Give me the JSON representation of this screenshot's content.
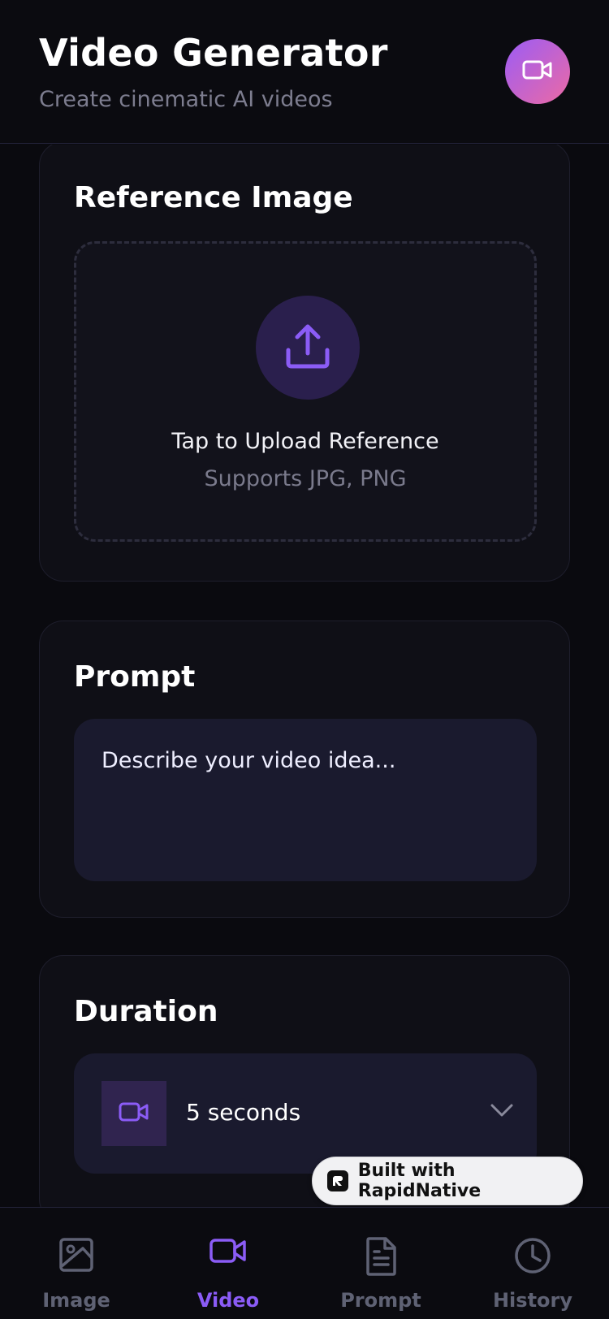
{
  "header": {
    "title": "Video Generator",
    "subtitle": "Create cinematic AI videos",
    "badge_icon": "video-camera-icon",
    "badge_gradient": [
      "#9b5cf6",
      "#ec6aa4"
    ]
  },
  "reference": {
    "title": "Reference Image",
    "upload_icon": "upload-icon",
    "upload_label": "Tap to Upload Reference",
    "upload_hint": "Supports JPG, PNG"
  },
  "prompt": {
    "title": "Prompt",
    "placeholder": "Describe your video idea..."
  },
  "duration": {
    "title": "Duration",
    "icon": "video-camera-icon",
    "selected": "5 seconds"
  },
  "built_with": {
    "label": "Built with RapidNative"
  },
  "tabs": [
    {
      "label": "Image",
      "icon": "image-icon",
      "active": false
    },
    {
      "label": "Video",
      "icon": "video-camera-icon",
      "active": true
    },
    {
      "label": "Prompt",
      "icon": "document-icon",
      "active": false
    },
    {
      "label": "History",
      "icon": "clock-icon",
      "active": false
    }
  ],
  "colors": {
    "accent": "#8b5cf6",
    "background": "#0a0a0f",
    "card": "#0f0f16",
    "input": "#1a1a2e",
    "muted": "#7d7d8f"
  }
}
